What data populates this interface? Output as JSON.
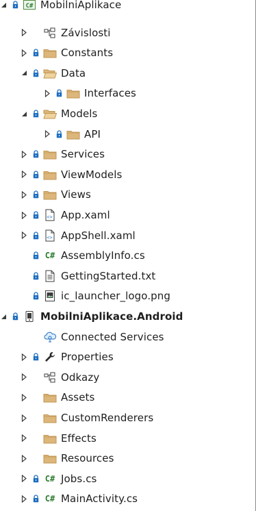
{
  "tree": {
    "items": [
      {
        "label": "MobilniAplikace",
        "depth": 0,
        "state": "expanded",
        "lock": true,
        "icon": "csharp-project-icon"
      },
      {
        "label": "Závislosti",
        "depth": 1,
        "state": "collapsed",
        "lock": false,
        "icon": "dependencies-icon"
      },
      {
        "label": "Constants",
        "depth": 1,
        "state": "collapsed",
        "lock": true,
        "icon": "folder-icon"
      },
      {
        "label": "Data",
        "depth": 1,
        "state": "expanded",
        "lock": true,
        "icon": "folder-open-icon"
      },
      {
        "label": "Interfaces",
        "depth": 2,
        "state": "collapsed",
        "lock": true,
        "icon": "folder-icon"
      },
      {
        "label": "Models",
        "depth": 1,
        "state": "expanded",
        "lock": true,
        "icon": "folder-open-icon"
      },
      {
        "label": "API",
        "depth": 2,
        "state": "collapsed",
        "lock": true,
        "icon": "folder-icon"
      },
      {
        "label": "Services",
        "depth": 1,
        "state": "collapsed",
        "lock": true,
        "icon": "folder-icon"
      },
      {
        "label": "ViewModels",
        "depth": 1,
        "state": "collapsed",
        "lock": true,
        "icon": "folder-icon"
      },
      {
        "label": "Views",
        "depth": 1,
        "state": "collapsed",
        "lock": true,
        "icon": "folder-icon"
      },
      {
        "label": "App.xaml",
        "depth": 1,
        "state": "collapsed",
        "lock": true,
        "icon": "xaml-file-icon"
      },
      {
        "label": "AppShell.xaml",
        "depth": 1,
        "state": "collapsed",
        "lock": true,
        "icon": "xaml-file-icon"
      },
      {
        "label": "AssemblyInfo.cs",
        "depth": 1,
        "state": "none",
        "lock": true,
        "icon": "csharp-file-icon"
      },
      {
        "label": "GettingStarted.txt",
        "depth": 1,
        "state": "none",
        "lock": true,
        "icon": "text-file-icon"
      },
      {
        "label": "ic_launcher_logo.png",
        "depth": 1,
        "state": "none",
        "lock": true,
        "icon": "image-file-icon"
      },
      {
        "label": "MobilniAplikace.Android",
        "depth": 0,
        "state": "expanded",
        "lock": true,
        "icon": "android-project-icon",
        "bold": true
      },
      {
        "label": "Connected Services",
        "depth": 1,
        "state": "none",
        "lock": false,
        "icon": "connected-services-icon"
      },
      {
        "label": "Properties",
        "depth": 1,
        "state": "collapsed",
        "lock": true,
        "icon": "wrench-icon"
      },
      {
        "label": "Odkazy",
        "depth": 1,
        "state": "collapsed",
        "lock": false,
        "icon": "dependencies-icon"
      },
      {
        "label": "Assets",
        "depth": 1,
        "state": "collapsed",
        "lock": false,
        "icon": "folder-icon"
      },
      {
        "label": "CustomRenderers",
        "depth": 1,
        "state": "collapsed",
        "lock": false,
        "icon": "folder-icon"
      },
      {
        "label": "Effects",
        "depth": 1,
        "state": "collapsed",
        "lock": false,
        "icon": "folder-icon"
      },
      {
        "label": "Resources",
        "depth": 1,
        "state": "collapsed",
        "lock": false,
        "icon": "folder-icon"
      },
      {
        "label": "Jobs.cs",
        "depth": 1,
        "state": "collapsed",
        "lock": true,
        "icon": "csharp-file-icon"
      },
      {
        "label": "MainActivity.cs",
        "depth": 1,
        "state": "collapsed",
        "lock": true,
        "icon": "csharp-file-icon"
      }
    ]
  },
  "colors": {
    "folder": "#dcb67a",
    "folder_edge": "#c09553",
    "lock": "#1f6fbf",
    "csharp": "#2e7d32",
    "tree_arrow": "#3c3c3c"
  }
}
